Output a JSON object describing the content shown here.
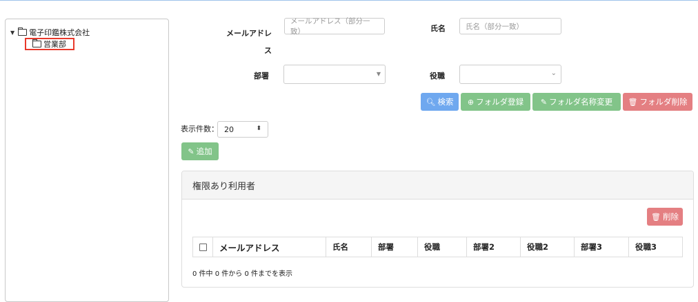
{
  "tree": {
    "root_label": "電子印鑑株式会社",
    "child_label": "営業部"
  },
  "search": {
    "email_label": "メールアドレス",
    "email_placeholder": "メールアドレス（部分一致）",
    "name_label": "氏名",
    "name_placeholder": "氏名（部分一致）",
    "dept_label": "部署",
    "position_label": "役職"
  },
  "actions": {
    "search": "検索",
    "folder_register": "フォルダ登録",
    "folder_rename": "フォルダ名称変更",
    "folder_delete": "フォルダ削除",
    "add": "追加"
  },
  "paging": {
    "per_page_label": "表示件数：",
    "per_page_value": "20"
  },
  "panel": {
    "title": "権限あり利用者",
    "delete_button": "削除",
    "columns": [
      "メールアドレス",
      "氏名",
      "部署",
      "役職",
      "部署2",
      "役職2",
      "部署3",
      "役職3"
    ],
    "summary": "0 件中 0 件から 0 件までを表示"
  },
  "colors": {
    "primary": "#6fa8ef",
    "success": "#82c489",
    "danger": "#e47f82",
    "highlight": "#e8392b"
  }
}
